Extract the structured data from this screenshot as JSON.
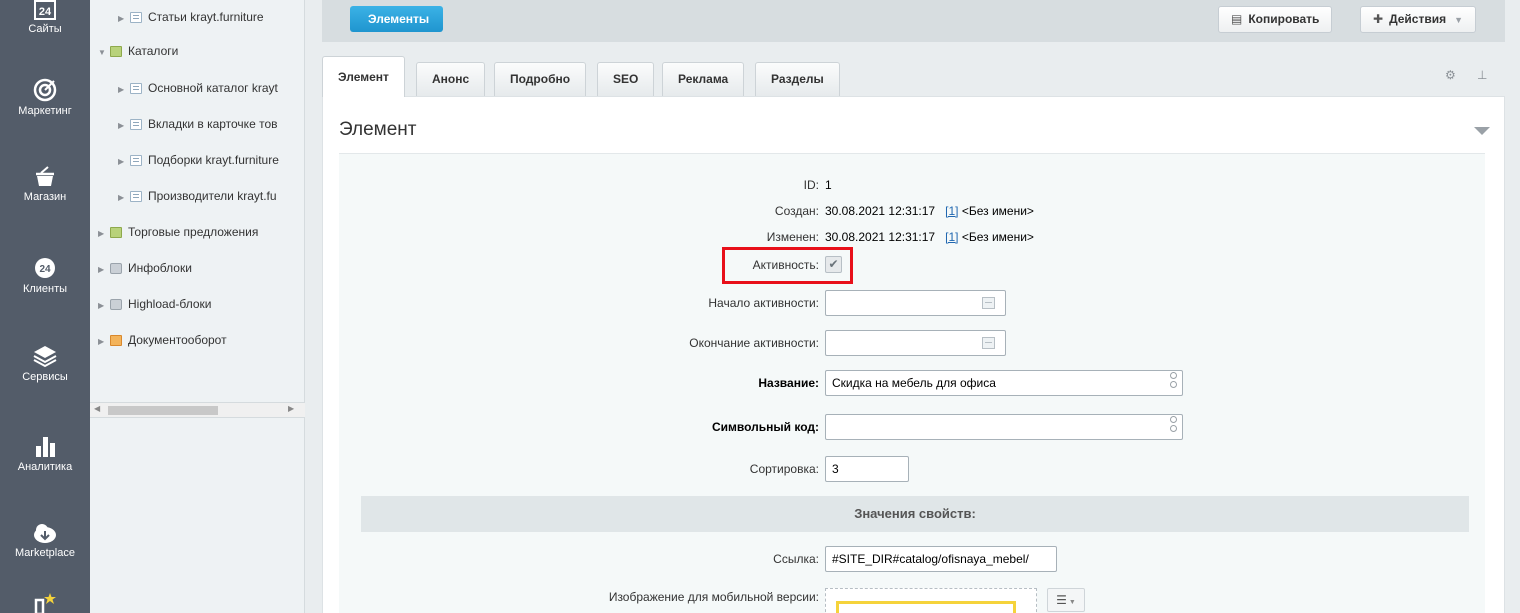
{
  "leftnav": {
    "items": [
      {
        "label": "Сайты",
        "icon": "calendar-24-icon"
      },
      {
        "label": "Маркетинг",
        "icon": "target-icon"
      },
      {
        "label": "Магазин",
        "icon": "basket-icon"
      },
      {
        "label": "Клиенты",
        "icon": "clients-24-icon"
      },
      {
        "label": "Сервисы",
        "icon": "layers-icon"
      },
      {
        "label": "Аналитика",
        "icon": "bar-chart-icon"
      },
      {
        "label": "Marketplace",
        "icon": "cloud-download-icon"
      }
    ],
    "badge_24": "24"
  },
  "tree": {
    "items": [
      {
        "label": "Статьи krayt.furniture",
        "icon": "page-icon"
      },
      {
        "label": "Каталоги",
        "icon": "folder-green-icon"
      },
      {
        "label": "Основной каталог krayt",
        "icon": "page-icon"
      },
      {
        "label": "Вкладки в карточке тов",
        "icon": "page-icon"
      },
      {
        "label": "Подборки krayt.furniture",
        "icon": "page-icon"
      },
      {
        "label": "Производители krayt.fu",
        "icon": "page-icon"
      },
      {
        "label": "Торговые предложения",
        "icon": "folder-green-icon"
      },
      {
        "label": "Инфоблоки",
        "icon": "gear-folder-icon"
      },
      {
        "label": "Highload-блоки",
        "icon": "gear-folder-icon"
      },
      {
        "label": "Документооборот",
        "icon": "document-icon"
      }
    ]
  },
  "topbar": {
    "breadcrumb": "Элементы",
    "copy_label": "Копировать",
    "actions_label": "Действия"
  },
  "tabs": [
    {
      "label": "Элемент",
      "active": true
    },
    {
      "label": "Анонс",
      "active": false
    },
    {
      "label": "Подробно",
      "active": false
    },
    {
      "label": "SEO",
      "active": false
    },
    {
      "label": "Реклама",
      "active": false
    },
    {
      "label": "Разделы",
      "active": false
    }
  ],
  "panel": {
    "title": "Элемент",
    "fields": {
      "id_label": "ID:",
      "id_value": "1",
      "created_label": "Создан:",
      "created_date": "30.08.2021 12:31:17",
      "created_user_link": "[1]",
      "created_user_name": "<Без имени>",
      "modified_label": "Изменен:",
      "modified_date": "30.08.2021 12:31:17",
      "modified_user_link": "[1]",
      "modified_user_name": "<Без имени>",
      "active_label": "Активность:",
      "active_checked": true,
      "active_from_label": "Начало активности:",
      "active_from_value": "",
      "active_to_label": "Окончание активности:",
      "active_to_value": "",
      "name_label": "Название:",
      "name_value": "Скидка на мебель для офиса",
      "code_label": "Символьный код:",
      "code_value": "",
      "sort_label": "Сортировка:",
      "sort_value": "3"
    },
    "properties": {
      "header": "Значения свойств:",
      "link_label": "Ссылка:",
      "link_value": "#SITE_DIR#catalog/ofisnaya_mebel/",
      "mobile_image_label": "Изображение для мобильной версии:"
    }
  }
}
